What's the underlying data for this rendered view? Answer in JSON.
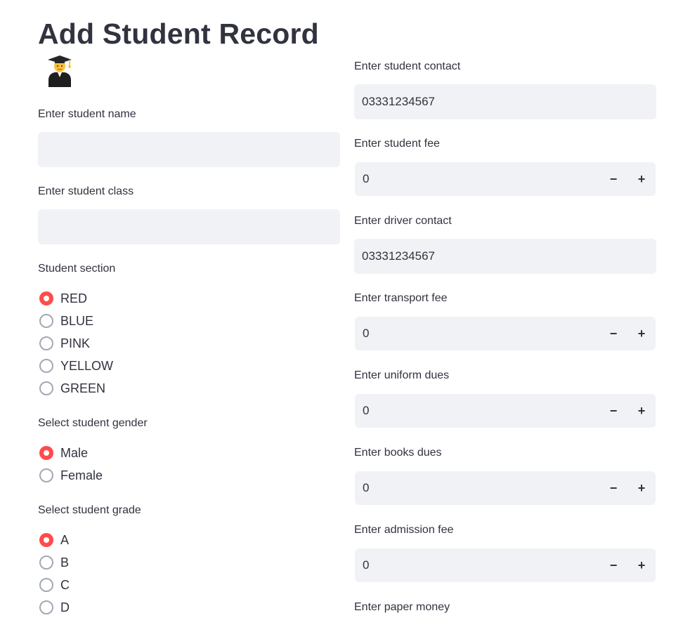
{
  "page": {
    "title": "Add Student Record",
    "icon": "graduate-emoji-icon"
  },
  "left": {
    "name_label": "Enter student name",
    "name_value": "",
    "class_label": "Enter student class",
    "class_value": "",
    "section": {
      "label": "Student section",
      "options": [
        "RED",
        "BLUE",
        "PINK",
        "YELLOW",
        "GREEN"
      ],
      "selected": "RED"
    },
    "gender": {
      "label": "Select student gender",
      "options": [
        "Male",
        "Female"
      ],
      "selected": "Male"
    },
    "grade": {
      "label": "Select student grade",
      "options": [
        "A",
        "B",
        "C",
        "D"
      ],
      "selected": "A"
    }
  },
  "right": {
    "contact_label": "Enter student contact",
    "contact_value": "03331234567",
    "fee_label": "Enter student fee",
    "fee_value": "0",
    "driver_label": "Enter driver contact",
    "driver_value": "03331234567",
    "transport_label": "Enter transport fee",
    "transport_value": "0",
    "uniform_label": "Enter uniform dues",
    "uniform_value": "0",
    "books_label": "Enter books dues",
    "books_value": "0",
    "admission_label": "Enter admission fee",
    "admission_value": "0",
    "paper_label": "Enter paper money"
  },
  "stepper": {
    "minus": "−",
    "plus": "+"
  },
  "colors": {
    "accent": "#ff4b4b",
    "input_bg": "#f0f2f6",
    "text": "#31333f"
  }
}
